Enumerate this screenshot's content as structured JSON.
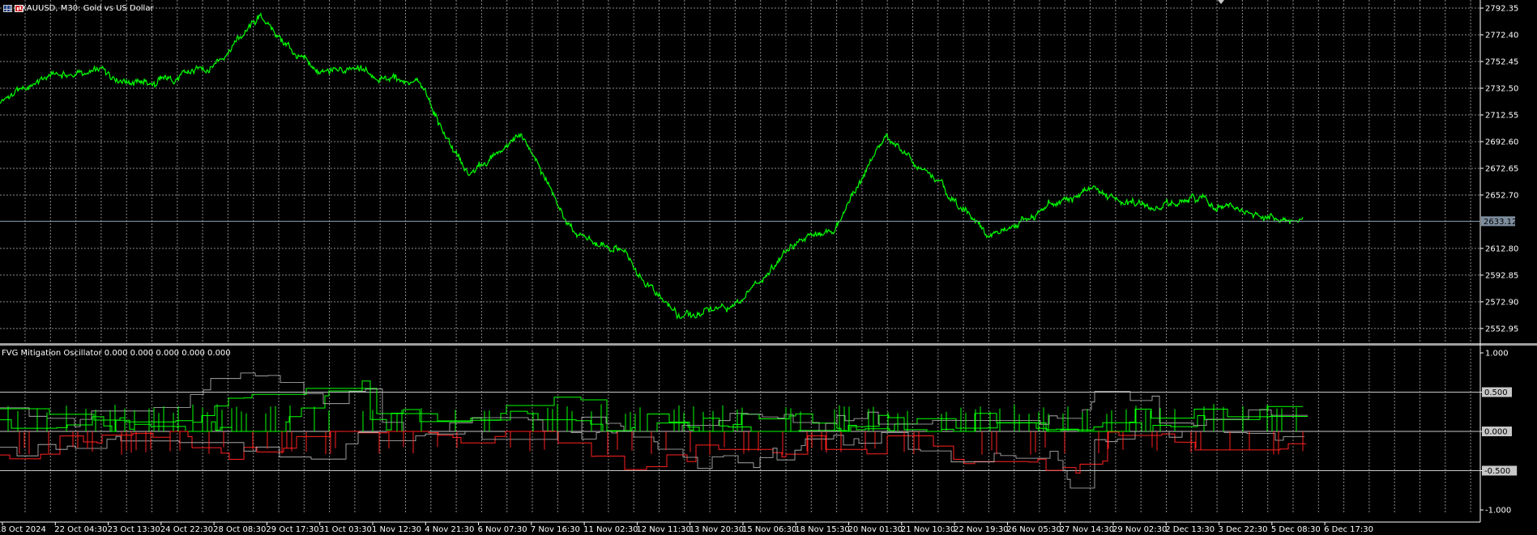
{
  "window": {
    "symbol_title": "XAUUSD, M30:  Gold vs US Dollar",
    "price_pane": {
      "ylim": [
        2542.0,
        2796.0
      ],
      "ticks": [
        "2792.35",
        "2772.40",
        "2752.45",
        "2732.50",
        "2712.55",
        "2692.60",
        "2672.65",
        "2652.70",
        "2612.80",
        "2592.85",
        "2572.90",
        "2552.95"
      ],
      "current_price": "2633.12",
      "line_color": "#00ff00"
    },
    "oscillator_pane": {
      "title": "FVG Mitigation Oscillator 0.000 0.000 0.000 0.000 0.000",
      "ylim": [
        -1.0,
        1.0
      ],
      "ticks": [
        "1.000",
        "0.500",
        "0.000",
        "-0.500",
        "-1.000"
      ],
      "bull_color": "#00ff00",
      "bear_color": "#ff2020",
      "mid_color": "#c0c0c0"
    },
    "time_axis": [
      "18 Oct 2024",
      "22 Oct 04:30",
      "23 Oct 13:30",
      "24 Oct 22:30",
      "28 Oct 08:30",
      "29 Oct 17:30",
      "31 Oct 03:30",
      "1 Nov 12:30",
      "4 Nov 21:30",
      "6 Nov 07:30",
      "7 Nov 16:30",
      "11 Nov 02:30",
      "12 Nov 11:30",
      "13 Nov 20:30",
      "15 Nov 06:30",
      "18 Nov 15:30",
      "20 Nov 01:30",
      "21 Nov 10:30",
      "22 Nov 19:30",
      "26 Nov 05:30",
      "27 Nov 14:30",
      "29 Nov 02:30",
      "2 Dec 13:30",
      "3 Dec 22:30",
      "5 Dec 08:30",
      "6 Dec 17:30"
    ]
  },
  "chart_data": {
    "type": "line",
    "title": "XAUUSD, M30:  Gold vs US Dollar",
    "xlabel": "",
    "ylabel": "",
    "categories": [
      "18 Oct 2024",
      "22 Oct 04:30",
      "23 Oct 13:30",
      "24 Oct 22:30",
      "28 Oct 08:30",
      "29 Oct 17:30",
      "31 Oct 03:30",
      "1 Nov 12:30",
      "4 Nov 21:30",
      "6 Nov 07:30",
      "7 Nov 16:30",
      "11 Nov 02:30",
      "12 Nov 11:30",
      "13 Nov 20:30",
      "15 Nov 06:30",
      "18 Nov 15:30",
      "20 Nov 01:30",
      "21 Nov 10:30",
      "22 Nov 19:30",
      "26 Nov 05:30",
      "27 Nov 14:30",
      "29 Nov 02:30",
      "2 Dec 13:30",
      "3 Dec 22:30",
      "5 Dec 08:30",
      "6 Dec 17:30"
    ],
    "series": [
      {
        "name": "XAUUSD",
        "values": [
          2723,
          2742,
          2744,
          2735,
          2748,
          2785,
          2745,
          2744,
          2738,
          2665,
          2700,
          2621,
          2609,
          2562,
          2567,
          2608,
          2630,
          2697,
          2662,
          2620,
          2643,
          2655,
          2642,
          2648,
          2637,
          2633
        ]
      }
    ],
    "grid": true,
    "ylim": [
      2542.0,
      2796.0
    ]
  }
}
